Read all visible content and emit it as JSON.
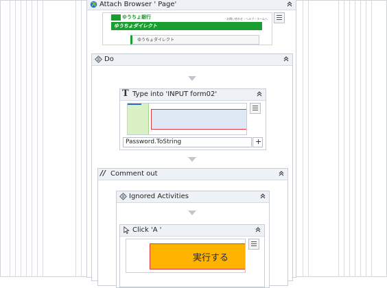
{
  "attach_browser": {
    "title": "Attach Browser '          Page'"
  },
  "bank_page": {
    "logo_text": "ゆうちょ銀行",
    "nav_text": "・お問い合わせ・ヘルプ・ホームへ",
    "brand_banner": "ゆうちょダイレクト",
    "breadcrumb": "ゆうちょダイレクト"
  },
  "do_sequence": {
    "title": "Do"
  },
  "type_into": {
    "title": "Type into 'INPUT  form02'",
    "text_value": "Password.ToString",
    "add_label": "+"
  },
  "comment_out": {
    "title": "Comment out"
  },
  "ignored_activities": {
    "title": "Ignored Activities"
  },
  "click": {
    "title": "Click 'A '",
    "button_label": "実行する"
  },
  "colors": {
    "header_bg": "#eef1f5",
    "bank_green": "#1a9e2f",
    "execute_button": "#ffb300",
    "selection_red": "#d93a3a"
  }
}
